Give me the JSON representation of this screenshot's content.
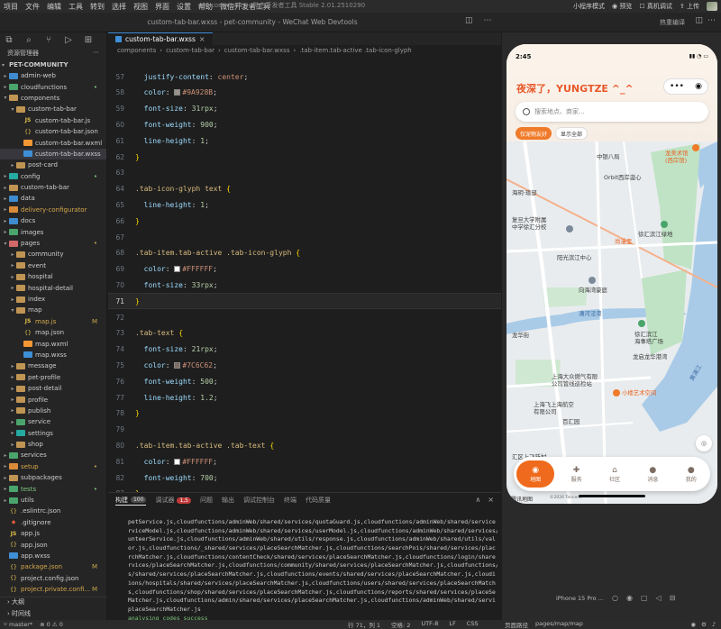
{
  "menu": [
    "项目",
    "文件",
    "编辑",
    "工具",
    "转到",
    "选择",
    "视图",
    "界面",
    "设置",
    "帮助",
    "微信开发者工具"
  ],
  "app_title": "pet-community - 微信开发者工具 Stable 2.01.2510290",
  "toolbar_right": {
    "mode": "小程序模式",
    "preview": "预览",
    "real_debug": "真机调试",
    "upload": "上传"
  },
  "window_title": "custom-tab-bar.wxss - pet-community - WeChat Web Devtools",
  "sim_tool_label": "热重编译",
  "explorer": {
    "header": "资源管理器",
    "project": "PET-COMMUNITY",
    "items": [
      {
        "label": "admin-web",
        "depth": 1,
        "type": "folder",
        "color": "folder-blue",
        "expanded": false
      },
      {
        "label": "cloudfunctions",
        "depth": 1,
        "type": "folder",
        "color": "folder-green",
        "expanded": false,
        "dot": "•",
        "badge_color": "#7fc97f"
      },
      {
        "label": "components",
        "depth": 1,
        "type": "folder",
        "color": "folder-src",
        "expanded": true
      },
      {
        "label": "custom-tab-bar",
        "depth": 2,
        "type": "folder",
        "color": "folder-src",
        "expanded": true
      },
      {
        "label": "custom-tab-bar.js",
        "depth": 3,
        "type": "js"
      },
      {
        "label": "custom-tab-bar.json",
        "depth": 3,
        "type": "json"
      },
      {
        "label": "custom-tab-bar.wxml",
        "depth": 3,
        "type": "wxml"
      },
      {
        "label": "custom-tab-bar.wxss",
        "depth": 3,
        "type": "wxss",
        "selected": true
      },
      {
        "label": "post-card",
        "depth": 2,
        "type": "folder",
        "color": "folder-src",
        "expanded": false
      },
      {
        "label": "config",
        "depth": 1,
        "type": "folder",
        "color": "folder-teal",
        "expanded": false,
        "dot": "•",
        "badge_color": "#7fc97f"
      },
      {
        "label": "custom-tab-bar",
        "depth": 1,
        "type": "folder",
        "color": "folder-src",
        "expanded": false
      },
      {
        "label": "data",
        "depth": 1,
        "type": "folder",
        "color": "folder-blue",
        "expanded": false
      },
      {
        "label": "delivery-configurator",
        "depth": 1,
        "type": "folder",
        "color": "folder-orange",
        "expanded": false,
        "label_color": "#d6a84a"
      },
      {
        "label": "docs",
        "depth": 1,
        "type": "folder",
        "color": "folder-blue",
        "expanded": false
      },
      {
        "label": "images",
        "depth": 1,
        "type": "folder",
        "color": "folder-green",
        "expanded": false
      },
      {
        "label": "pages",
        "depth": 1,
        "type": "folder",
        "color": "folder-red",
        "expanded": true,
        "dot": "•",
        "badge_color": "#c9a64c"
      },
      {
        "label": "community",
        "depth": 2,
        "type": "folder",
        "color": "folder-src",
        "expanded": false
      },
      {
        "label": "event",
        "depth": 2,
        "type": "folder",
        "color": "folder-src",
        "expanded": false
      },
      {
        "label": "hospital",
        "depth": 2,
        "type": "folder",
        "color": "folder-src",
        "expanded": false
      },
      {
        "label": "hospital-detail",
        "depth": 2,
        "type": "folder",
        "color": "folder-src",
        "expanded": false
      },
      {
        "label": "index",
        "depth": 2,
        "type": "folder",
        "color": "folder-src",
        "expanded": false
      },
      {
        "label": "map",
        "depth": 2,
        "type": "folder",
        "color": "folder-src",
        "expanded": true
      },
      {
        "label": "map.js",
        "depth": 3,
        "type": "js",
        "badge": "M",
        "label_color": "#d6a84a"
      },
      {
        "label": "map.json",
        "depth": 3,
        "type": "json"
      },
      {
        "label": "map.wxml",
        "depth": 3,
        "type": "wxml"
      },
      {
        "label": "map.wxss",
        "depth": 3,
        "type": "wxss"
      },
      {
        "label": "message",
        "depth": 2,
        "type": "folder",
        "color": "folder-src",
        "expanded": false
      },
      {
        "label": "pet-profile",
        "depth": 2,
        "type": "folder",
        "color": "folder-src",
        "expanded": false
      },
      {
        "label": "post-detail",
        "depth": 2,
        "type": "folder",
        "color": "folder-src",
        "expanded": false
      },
      {
        "label": "profile",
        "depth": 2,
        "type": "folder",
        "color": "folder-src",
        "expanded": false
      },
      {
        "label": "publish",
        "depth": 2,
        "type": "folder",
        "color": "folder-src",
        "expanded": false
      },
      {
        "label": "service",
        "depth": 2,
        "type": "folder",
        "color": "folder-green",
        "expanded": false
      },
      {
        "label": "settings",
        "depth": 2,
        "type": "folder",
        "color": "folder-teal",
        "expanded": false
      },
      {
        "label": "shop",
        "depth": 2,
        "type": "folder",
        "color": "folder-src",
        "expanded": false
      },
      {
        "label": "services",
        "depth": 1,
        "type": "folder",
        "color": "folder-green",
        "expanded": false
      },
      {
        "label": "setup",
        "depth": 1,
        "type": "folder",
        "color": "folder-orange",
        "expanded": false,
        "dot": "•",
        "badge_color": "#c9a64c",
        "label_color": "#d6a84a"
      },
      {
        "label": "subpackages",
        "depth": 1,
        "type": "folder",
        "color": "folder-src",
        "expanded": false
      },
      {
        "label": "tests",
        "depth": 1,
        "type": "folder",
        "color": "folder-green",
        "expanded": false,
        "dot": "•",
        "badge_color": "#7fc97f",
        "label_color": "#7fc97f"
      },
      {
        "label": "utils",
        "depth": 1,
        "type": "folder",
        "color": "folder-green",
        "expanded": false
      },
      {
        "label": ".eslintrc.json",
        "depth": 1,
        "type": "json"
      },
      {
        "label": ".gitignore",
        "depth": 1,
        "type": "git"
      },
      {
        "label": "app.js",
        "depth": 1,
        "type": "js"
      },
      {
        "label": "app.json",
        "depth": 1,
        "type": "json"
      },
      {
        "label": "app.wxss",
        "depth": 1,
        "type": "wxss"
      },
      {
        "label": "package.json",
        "depth": 1,
        "type": "json",
        "badge": "M",
        "label_color": "#d6a84a"
      },
      {
        "label": "project.config.json",
        "depth": 1,
        "type": "json"
      },
      {
        "label": "project.private.confi...",
        "depth": 1,
        "type": "json",
        "badge": "M",
        "label_color": "#d6a84a"
      }
    ],
    "outline": "大纲",
    "timeline": "时间线"
  },
  "editor": {
    "tab_label": "custom-tab-bar.wxss",
    "breadcrumb": [
      "components",
      "custom-tab-bar",
      "custom-tab-bar.wxss",
      ".tab-item.tab-active .tab-icon-glyph"
    ],
    "lines": [
      {
        "n": "57",
        "text": "  justify-content: center;",
        "kind": "decl",
        "prop": "justify-content",
        "value": "center"
      },
      {
        "n": "58",
        "kind": "decl-color",
        "prop": "color",
        "value": "#9A928B",
        "swatch": "#9A928B"
      },
      {
        "n": "59",
        "kind": "decl-num",
        "prop": "font-size",
        "num": "31",
        "unit": "rpx"
      },
      {
        "n": "60",
        "kind": "decl-num",
        "prop": "font-weight",
        "num": "900",
        "unit": ""
      },
      {
        "n": "61",
        "kind": "decl-num",
        "prop": "line-height",
        "num": "1",
        "unit": ""
      },
      {
        "n": "62",
        "kind": "close"
      },
      {
        "n": "63",
        "kind": "blank"
      },
      {
        "n": "64",
        "kind": "selector",
        "text": ".tab-icon-glyph text"
      },
      {
        "n": "65",
        "kind": "decl-num",
        "prop": "line-height",
        "num": "1",
        "unit": ""
      },
      {
        "n": "66",
        "kind": "close"
      },
      {
        "n": "67",
        "kind": "blank"
      },
      {
        "n": "68",
        "kind": "selector",
        "text": ".tab-item.tab-active .tab-icon-glyph"
      },
      {
        "n": "69",
        "kind": "decl-color",
        "prop": "color",
        "value": "#FFFFFF",
        "swatch": "#FFFFFF"
      },
      {
        "n": "70",
        "kind": "decl-num",
        "prop": "font-size",
        "num": "33",
        "unit": "rpx"
      },
      {
        "n": "71",
        "kind": "close",
        "current": true
      },
      {
        "n": "72",
        "kind": "blank"
      },
      {
        "n": "73",
        "kind": "selector",
        "text": ".tab-text"
      },
      {
        "n": "74",
        "kind": "decl-num",
        "prop": "font-size",
        "num": "21",
        "unit": "rpx"
      },
      {
        "n": "75",
        "kind": "decl-color",
        "prop": "color",
        "value": "#7C6C62",
        "swatch": "#7C6C62"
      },
      {
        "n": "76",
        "kind": "decl-num",
        "prop": "font-weight",
        "num": "500",
        "unit": ""
      },
      {
        "n": "77",
        "kind": "decl-num",
        "prop": "line-height",
        "num": "1.2",
        "unit": ""
      },
      {
        "n": "78",
        "kind": "close"
      },
      {
        "n": "79",
        "kind": "blank"
      },
      {
        "n": "80",
        "kind": "selector",
        "text": ".tab-item.tab-active .tab-text"
      },
      {
        "n": "81",
        "kind": "decl-color",
        "prop": "color",
        "value": "#FFFFFF",
        "swatch": "#FFFFFF"
      },
      {
        "n": "82",
        "kind": "decl-num",
        "prop": "font-weight",
        "num": "700",
        "unit": ""
      },
      {
        "n": "83",
        "kind": "close"
      }
    ]
  },
  "panel": {
    "tabs": [
      {
        "label": "构建",
        "count": "100",
        "active": true
      },
      {
        "label": "调试器",
        "count": "1,5",
        "red": true
      },
      {
        "label": "问题"
      },
      {
        "label": "输出"
      },
      {
        "label": "调试控制台"
      },
      {
        "label": "终端"
      },
      {
        "label": "代码质量"
      }
    ],
    "log": [
      "petService.js,cloudfunctions/adminWeb/shared/services/quotaGuard.js,cloudfunctions/adminWeb/shared/service",
      "rviceModel.js,cloudfunctions/adminWeb/shared/services/userModel.js,cloudfunctions/adminWeb/shared/services/",
      "unteerService.js,cloudfunctions/adminWeb/shared/utils/response.js,cloudfunctions/adminWeb/shared/utils/val",
      "or.js,cloudfunctions/_shared/services/placeSearchMatcher.js,cloudfunctions/searchPois/shared/services/plac",
      "rchMatcher.js,cloudfunctions/contentCheck/shared/services/placeSearchMatcher.js,cloudfunctions/login/share",
      "rvices/placeSearchMatcher.js,cloudfunctions/community/shared/services/placeSearchMatcher.js,cloudfunctions/",
      "s/shared/services/placeSearchMatcher.js,cloudfunctions/events/shared/services/placeSearchMatcher.js,cloudi",
      "ions/hospitals/shared/services/placeSearchMatcher.js,cloudfunctions/users/shared/services/placeSearchMatch",
      "s,cloudfunctions/shop/shared/services/placeSearchMatcher.js,cloudfunctions/reports/shared/services/placeSe",
      "Matcher.js,cloudfunctions/admin/shared/services/placeSearchMatcher.js,cloudfunctions/adminWeb/shared/servi",
      "placeSearchMatcher.js",
      "analysing codes success"
    ]
  },
  "phone": {
    "time": "2:45",
    "greeting": "夜深了，YUNGTZE ^_^",
    "search_placeholder": "搜索地点、商家...",
    "chips": [
      "仅宠物友好",
      "显示全部"
    ],
    "map_labels": [
      {
        "text": "中银八局",
        "cls": ""
      },
      {
        "text": "龙美术馆",
        "cls": "orange"
      },
      {
        "text": "(西岸馆)",
        "cls": "orange"
      },
      {
        "text": "Orbit西岸漩心",
        "cls": ""
      },
      {
        "text": "海玥·瑄邸",
        "cls": ""
      },
      {
        "text": "复旦大学附属",
        "cls": ""
      },
      {
        "text": "中学徐汇分校",
        "cls": ""
      },
      {
        "text": "徐汇滨江绿地",
        "cls": ""
      },
      {
        "text": "尚漫里",
        "cls": "orange"
      },
      {
        "text": "阳光滨江中心",
        "cls": ""
      },
      {
        "text": "向海湾豪庭",
        "cls": ""
      },
      {
        "text": "漕河泾港",
        "cls": "blue"
      },
      {
        "text": "龙华街",
        "cls": ""
      },
      {
        "text": "徐汇滨江",
        "cls": ""
      },
      {
        "text": "海事塔广场",
        "cls": ""
      },
      {
        "text": "龙启龙华港湾",
        "cls": ""
      },
      {
        "text": "黄浦江",
        "cls": "blue"
      },
      {
        "text": "上海大众燃气有限",
        "cls": ""
      },
      {
        "text": "公司管线巡检站",
        "cls": ""
      },
      {
        "text": "小楼艺术空间",
        "cls": "orange"
      },
      {
        "text": "上海飞上海航空",
        "cls": ""
      },
      {
        "text": "有限公司",
        "cls": ""
      },
      {
        "text": "百汇园",
        "cls": ""
      },
      {
        "text": "汇区上飞新村",
        "cls": ""
      }
    ],
    "tabs": [
      {
        "label": "地图",
        "glyph": "◉",
        "active": true
      },
      {
        "label": "服务",
        "glyph": "✚"
      },
      {
        "label": "社区",
        "glyph": "⌂"
      },
      {
        "label": "消息",
        "glyph": "●"
      },
      {
        "label": "我的",
        "glyph": "●"
      }
    ],
    "map_logo": "腾讯地图",
    "map_copyright": "©2026 Tencent",
    "device": "iPhone 15 Pro ..."
  },
  "statusbar": {
    "branch": "master*",
    "sync": "⊗ 0 ⚠ 0",
    "position": "行 71，列 1",
    "spaces": "空格: 2",
    "encoding": "UTF-8",
    "eol": "LF",
    "lang": "CSS",
    "page_path_label": "页面路径",
    "page_path": "pages/map/map"
  }
}
